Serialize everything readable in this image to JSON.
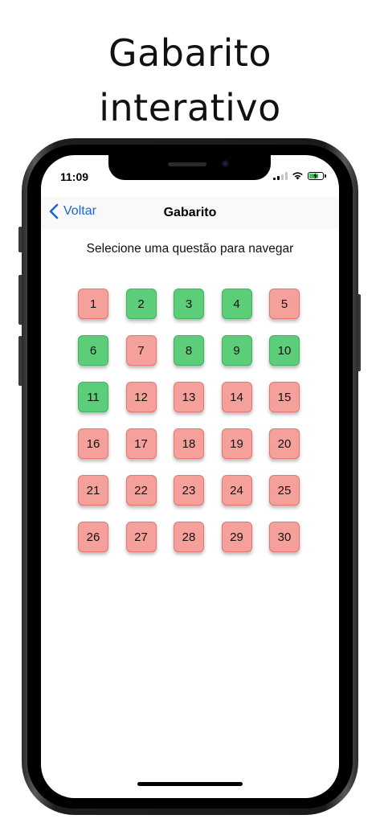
{
  "promo": {
    "title_line1": "Gabarito",
    "title_line2": "interativo"
  },
  "status_bar": {
    "time": "11:09",
    "battery_color": "#35c759"
  },
  "nav": {
    "back_label": "Voltar",
    "title": "Gabarito",
    "accent_color": "#1a66d6"
  },
  "instruction": "Selecione uma questão para navegar",
  "colors": {
    "correct": "#5ccd78",
    "incorrect": "#f6a09c"
  },
  "questions": [
    {
      "number": "1",
      "status": "wrong"
    },
    {
      "number": "2",
      "status": "right"
    },
    {
      "number": "3",
      "status": "right"
    },
    {
      "number": "4",
      "status": "right"
    },
    {
      "number": "5",
      "status": "wrong"
    },
    {
      "number": "6",
      "status": "right"
    },
    {
      "number": "7",
      "status": "wrong"
    },
    {
      "number": "8",
      "status": "right"
    },
    {
      "number": "9",
      "status": "right"
    },
    {
      "number": "10",
      "status": "right"
    },
    {
      "number": "11",
      "status": "right"
    },
    {
      "number": "12",
      "status": "wrong"
    },
    {
      "number": "13",
      "status": "wrong"
    },
    {
      "number": "14",
      "status": "wrong"
    },
    {
      "number": "15",
      "status": "wrong"
    },
    {
      "number": "16",
      "status": "wrong"
    },
    {
      "number": "17",
      "status": "wrong"
    },
    {
      "number": "18",
      "status": "wrong"
    },
    {
      "number": "19",
      "status": "wrong"
    },
    {
      "number": "20",
      "status": "wrong"
    },
    {
      "number": "21",
      "status": "wrong"
    },
    {
      "number": "22",
      "status": "wrong"
    },
    {
      "number": "23",
      "status": "wrong"
    },
    {
      "number": "24",
      "status": "wrong"
    },
    {
      "number": "25",
      "status": "wrong"
    },
    {
      "number": "26",
      "status": "wrong"
    },
    {
      "number": "27",
      "status": "wrong"
    },
    {
      "number": "28",
      "status": "wrong"
    },
    {
      "number": "29",
      "status": "wrong"
    },
    {
      "number": "30",
      "status": "wrong"
    }
  ]
}
